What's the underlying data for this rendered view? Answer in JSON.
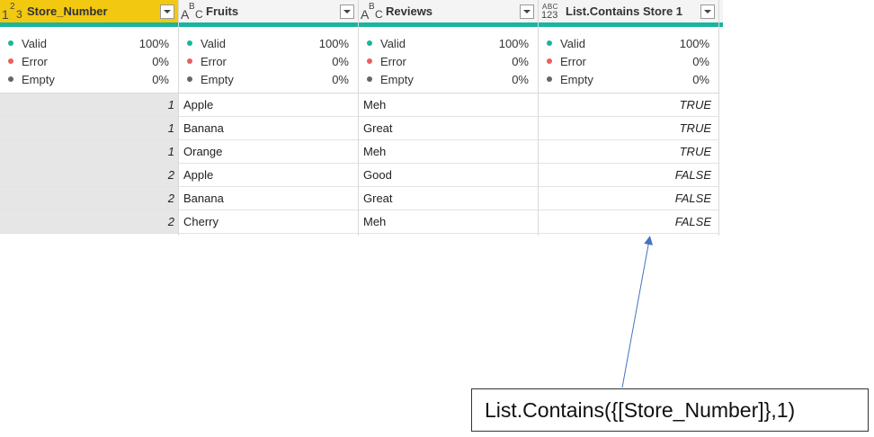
{
  "columns": [
    {
      "name": "Store_Number",
      "type_icon": "whole-number-icon",
      "type_glyph": [
        "1",
        "2",
        "3"
      ],
      "active": true,
      "quality": [
        {
          "label": "Valid",
          "value": "100%",
          "color": "#18b5a0"
        },
        {
          "label": "Error",
          "value": "0%",
          "color": "#e8605b"
        },
        {
          "label": "Empty",
          "value": "0%",
          "color": "#666666"
        }
      ],
      "cells": [
        "1",
        "1",
        "1",
        "2",
        "2",
        "2"
      ]
    },
    {
      "name": "Fruits",
      "type_icon": "text-type-icon",
      "type_glyph": [
        "A",
        "B",
        "C"
      ],
      "active": false,
      "quality": [
        {
          "label": "Valid",
          "value": "100%",
          "color": "#18b5a0"
        },
        {
          "label": "Error",
          "value": "0%",
          "color": "#e8605b"
        },
        {
          "label": "Empty",
          "value": "0%",
          "color": "#666666"
        }
      ],
      "cells": [
        "Apple",
        "Banana",
        "Orange",
        "Apple",
        "Banana",
        "Cherry"
      ]
    },
    {
      "name": "Reviews",
      "type_icon": "text-type-icon",
      "type_glyph": [
        "A",
        "B",
        "C"
      ],
      "active": false,
      "quality": [
        {
          "label": "Valid",
          "value": "100%",
          "color": "#18b5a0"
        },
        {
          "label": "Error",
          "value": "0%",
          "color": "#e8605b"
        },
        {
          "label": "Empty",
          "value": "0%",
          "color": "#666666"
        }
      ],
      "cells": [
        "Meh",
        "Great",
        "Meh",
        "Good",
        "Great",
        "Meh"
      ]
    },
    {
      "name": "List.Contains Store 1",
      "type_icon": "any-type-icon",
      "type_glyph": [
        "ABC",
        "123"
      ],
      "active": false,
      "quality": [
        {
          "label": "Valid",
          "value": "100%",
          "color": "#18b5a0"
        },
        {
          "label": "Error",
          "value": "0%",
          "color": "#e8605b"
        },
        {
          "label": "Empty",
          "value": "0%",
          "color": "#666666"
        }
      ],
      "cells": [
        "TRUE",
        "TRUE",
        "TRUE",
        "FALSE",
        "FALSE",
        "FALSE"
      ]
    }
  ],
  "callout": {
    "text": "List.Contains({[Store_Number]},1)"
  },
  "colors": {
    "header_accent": "#18b5a0",
    "active_header": "#f2c811",
    "arrow": "#4472c4"
  }
}
